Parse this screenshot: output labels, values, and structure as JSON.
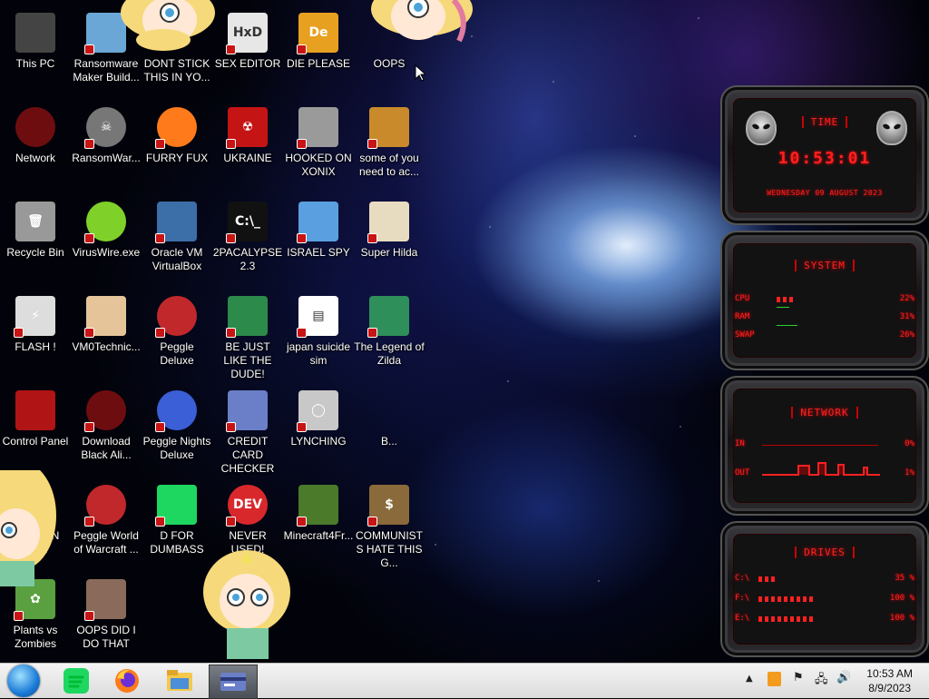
{
  "desktop_icons": [
    {
      "label": "This PC",
      "icon": "computer-icon"
    },
    {
      "label": "Ransomware Maker Build...",
      "icon": "window-icon"
    },
    {
      "label": "DONT STICK THIS IN YO...",
      "icon": "cartoon-girl-icon"
    },
    {
      "label": "SEX EDITOR",
      "icon": "hxd-icon"
    },
    {
      "label": "DIE PLEASE",
      "icon": "de-icon"
    },
    {
      "label": "OOPS",
      "icon": "cartoon-girl-icon"
    },
    {
      "label": "Network",
      "icon": "alien-globe-icon"
    },
    {
      "label": "RansomWar...",
      "icon": "skull-icon"
    },
    {
      "label": "FURRY FUX",
      "icon": "firefox-icon"
    },
    {
      "label": "UKRAINE",
      "icon": "radiation-icon"
    },
    {
      "label": "HOOKED ON XONIX",
      "icon": "xonix-icon"
    },
    {
      "label": "some of you need to ac...",
      "icon": "horse-icon"
    },
    {
      "label": "Recycle Bin",
      "icon": "trash-can-icon"
    },
    {
      "label": "VirusWire.exe",
      "icon": "lime-icon"
    },
    {
      "label": "Oracle VM VirtualBox",
      "icon": "virtualbox-icon"
    },
    {
      "label": "2PACALYPSE 2.3",
      "icon": "terminal-icon"
    },
    {
      "label": "ISRAEL SPY",
      "icon": "spy-network-icon"
    },
    {
      "label": "Super Hilda",
      "icon": "pixel-dog-icon"
    },
    {
      "label": "FLASH !",
      "icon": "flash-icon"
    },
    {
      "label": "VM0Technic...",
      "icon": "doctor-icon"
    },
    {
      "label": "Peggle Deluxe",
      "icon": "peggle-icon"
    },
    {
      "label": "BE JUST LIKE THE DUDE!",
      "icon": "santa-icon"
    },
    {
      "label": "japan suicide sim",
      "icon": "document-icon"
    },
    {
      "label": "The Legend of Zilda",
      "icon": "pixel-hero-icon"
    },
    {
      "label": "Control Panel",
      "icon": "control-panel-icon"
    },
    {
      "label": "Download Black Ali...",
      "icon": "alien-globe-icon"
    },
    {
      "label": "Peggle Nights Deluxe",
      "icon": "peggle-nights-icon"
    },
    {
      "label": "CREDIT CARD CHECKER",
      "icon": "credit-card-icon"
    },
    {
      "label": "LYNCHING",
      "icon": "noose-icon"
    },
    {
      "label": "B...",
      "icon": "cartoon-girl-icon"
    },
    {
      "label": "CHUZZIN CUM",
      "icon": "chuzzle-icon"
    },
    {
      "label": "Peggle World of Warcraft ...",
      "icon": "peggle-icon"
    },
    {
      "label": "D FOR DUMBASS",
      "icon": "spotify-icon"
    },
    {
      "label": "NEVER USED!",
      "icon": "devcpp-icon"
    },
    {
      "label": "Minecraft4Fr...",
      "icon": "minecraft-icon"
    },
    {
      "label": "COMMUNISTS HATE THIS G...",
      "icon": "money-bag-icon"
    },
    {
      "label": "Plants vs Zombies",
      "icon": "flower-icon"
    },
    {
      "label": "OOPS DID I DO THAT",
      "icon": "portrait-icon"
    }
  ],
  "gadget": {
    "time": {
      "title": "TIME",
      "clock": "10:53:01",
      "date": "WEDNESDAY 09 AUGUST 2023"
    },
    "system": {
      "title": "SYSTEM",
      "cpu_label": "CPU",
      "cpu_value": "22%",
      "cpu_fraction": 0.22,
      "ram_label": "RAM",
      "ram_value": "31%",
      "ram_fraction": 0.31,
      "swap_label": "SWAP",
      "swap_value": "26%",
      "swap_fraction": 0.26
    },
    "network": {
      "title": "NETWORK",
      "in_label": "IN",
      "in_value": "0%",
      "out_label": "OUT",
      "out_value": "1%"
    },
    "drives": {
      "title": "DRIVES",
      "items": [
        {
          "label": "C:\\",
          "value": "35 %",
          "fraction": 0.35
        },
        {
          "label": "F:\\",
          "value": "100 %",
          "fraction": 1.0
        },
        {
          "label": "E:\\",
          "value": "100 %",
          "fraction": 1.0
        }
      ]
    }
  },
  "taskbar": {
    "items": [
      "spotify-icon",
      "firefox-icon",
      "file-explorer-icon",
      "credit-card-icon"
    ],
    "tray": [
      "show-hidden-icon",
      "app-icon",
      "flag-icon",
      "network-icon",
      "volume-icon"
    ],
    "time": "10:53 AM",
    "date": "8/9/2023"
  }
}
